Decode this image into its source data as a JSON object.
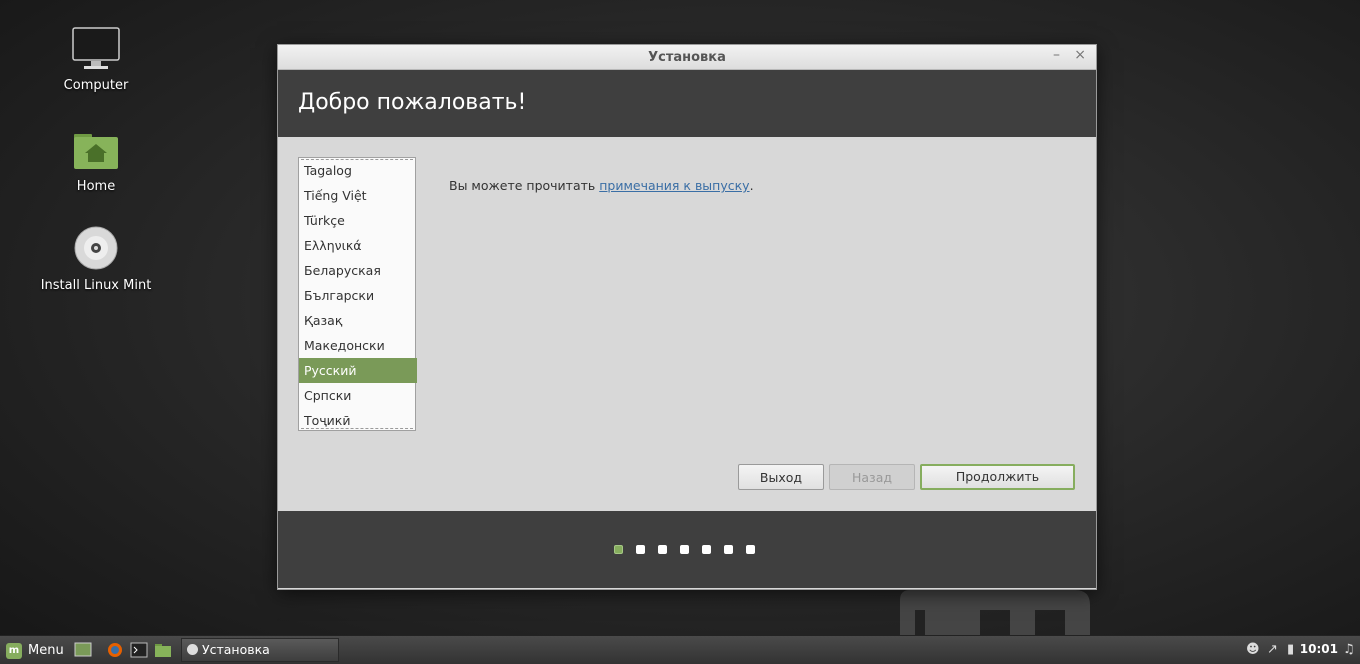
{
  "desktop": {
    "icons": [
      {
        "label": "Computer"
      },
      {
        "label": "Home"
      },
      {
        "label": "Install Linux Mint"
      }
    ]
  },
  "window": {
    "title": "Установка",
    "minimize_label": "–",
    "close_label": "×",
    "heading": "Добро пожаловать!",
    "languages": [
      "Tagalog",
      "Tiếng Việt",
      "Türkçe",
      "Ελληνικά",
      "Беларуская",
      "Български",
      "Қазақ",
      "Македонски",
      "Русский",
      "Српски",
      "Тоҷикӣ"
    ],
    "selected_language": "Русский",
    "notes_prefix": "Вы можете прочитать ",
    "notes_link": "примечания к выпуску",
    "notes_suffix": ".",
    "buttons": {
      "quit": "Выход",
      "back": "Назад",
      "continue": "Продолжить"
    },
    "progress": {
      "current_step": 1,
      "total_steps": 7
    }
  },
  "taskbar": {
    "menu_label": "Menu",
    "window_button_label": "Установка",
    "clock": "10:01"
  },
  "colors": {
    "accent": "#86ad5e",
    "selection": "#7a9a58",
    "header": "#3f3f3f"
  }
}
